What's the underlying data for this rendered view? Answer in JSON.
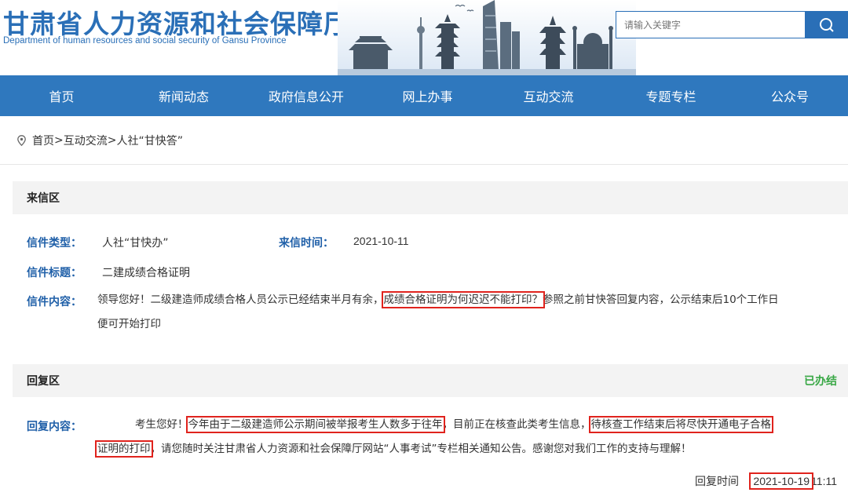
{
  "header": {
    "title": "甘肃省人力资源和社会保障厅",
    "subtitle": "Department of human resources and social security of Gansu Province",
    "search_placeholder": "请输入关键字"
  },
  "nav": {
    "items": [
      "首页",
      "新闻动态",
      "政府信息公开",
      "网上办事",
      "互动交流",
      "专题专栏",
      "公众号"
    ]
  },
  "breadcrumb": {
    "items": [
      "首页",
      "互动交流",
      "人社“甘快答”"
    ],
    "separator": ">"
  },
  "letter": {
    "section_title": "来信区",
    "type_label": "信件类型：",
    "type_value": "人社“甘快办”",
    "time_label": "来信时间：",
    "time_value": "2021-10-11",
    "subject_label": "信件标题：",
    "subject_value": "二建成绩合格证明",
    "content_label": "信件内容：",
    "content_part1": "领导您好！二级建造师成绩合格人员公示已经结束半月有余，",
    "content_highlight": "成绩合格证明为何迟迟不能打印？",
    "content_part2": "参照之前甘快答回复内容，公示结束后10个工作日",
    "content_part3": "便可开始打印"
  },
  "reply": {
    "section_title": "回复区",
    "status": "已办结",
    "content_label": "回复内容：",
    "p1": "考生您好！",
    "h1": "今年由于二级建造师公示期间被举报考生人数多于往年",
    "p2": "，目前正在核查此类考生信息，",
    "h2": "待核查工作结束后将尽快开通电子合格",
    "h3": "证明的打印",
    "p3": "，请您随时关注甘肃省人力资源和社会保障厅网站“人事考试”专栏相关通知公告。感谢您对我们工作的支持与理解！",
    "time_label": "回复时间",
    "time_date": "2021-10-19",
    "time_clock": "11:11"
  },
  "colors": {
    "brand_blue": "#2a6fb7",
    "nav_blue": "#2f78be",
    "label_blue": "#1f5fa8",
    "status_green": "#39a846",
    "highlight_red": "#e0231d"
  }
}
